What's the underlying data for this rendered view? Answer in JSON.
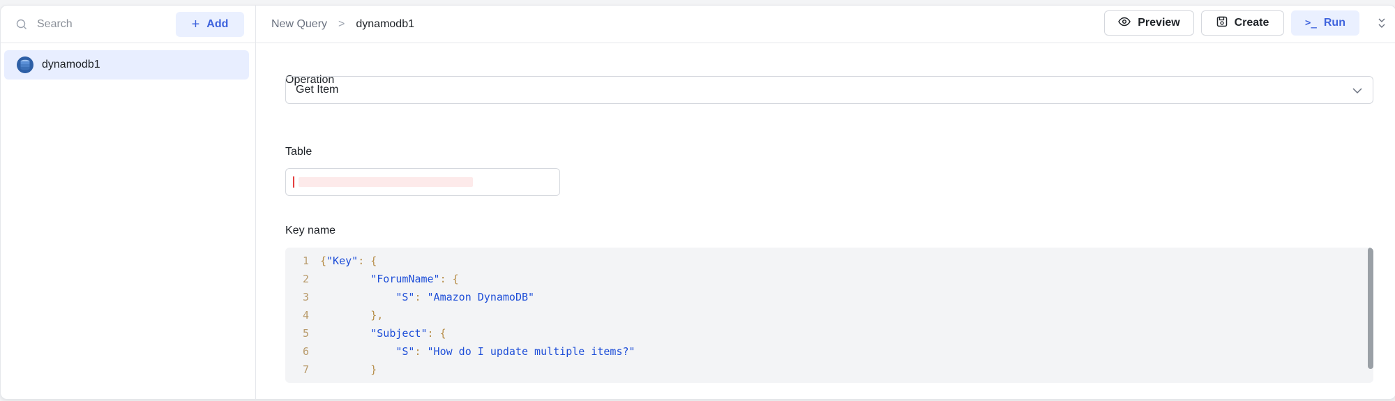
{
  "sidebar": {
    "search_placeholder": "Search",
    "add_label": "Add",
    "items": [
      {
        "label": "dynamodb1"
      }
    ]
  },
  "header": {
    "breadcrumb": [
      "New Query",
      ">",
      "dynamodb1"
    ],
    "preview_label": "Preview",
    "create_label": "Create",
    "run_label": "Run",
    "run_glyph": ">_",
    "collapse_glyph": "⌄"
  },
  "form": {
    "operation_label": "Operation",
    "operation_value": "Get Item",
    "table_label": "Table",
    "key_name_label": "Key name",
    "key_code": [
      "{\"Key\": {",
      "        \"ForumName\": {",
      "            \"S\": \"Amazon DynamoDB\"",
      "        },",
      "        \"Subject\": {",
      "            \"S\": \"How do I update multiple items?\"",
      "        }",
      "}"
    ]
  },
  "colors": {
    "accent": "#3e63dd",
    "accent_bg": "#eaf0ff",
    "code_key": "#1f4fd8",
    "code_punctuation": "#b78e4a",
    "line_number": "#b89a6a"
  }
}
